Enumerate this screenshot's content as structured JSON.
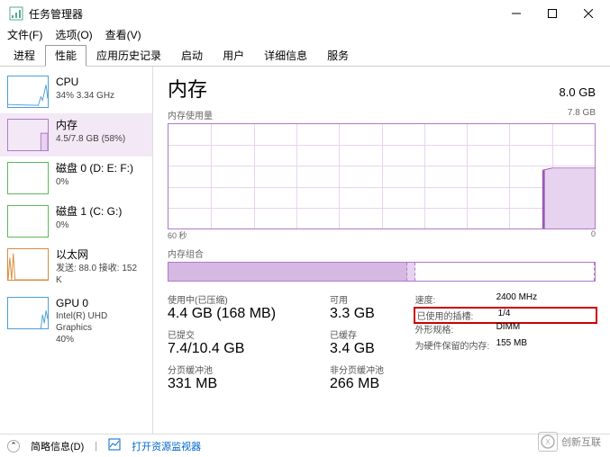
{
  "window": {
    "title": "任务管理器"
  },
  "menu": {
    "file": "文件(F)",
    "options": "选项(O)",
    "view": "查看(V)"
  },
  "tabs": {
    "processes": "进程",
    "performance": "性能",
    "app_history": "应用历史记录",
    "startup": "启动",
    "users": "用户",
    "details": "详细信息",
    "services": "服务"
  },
  "sidebar": {
    "cpu": {
      "name": "CPU",
      "sub": "34% 3.34 GHz"
    },
    "memory": {
      "name": "内存",
      "sub": "4.5/7.8 GB (58%)"
    },
    "disk0": {
      "name": "磁盘 0 (D: E: F:)",
      "sub": "0%"
    },
    "disk1": {
      "name": "磁盘 1 (C: G:)",
      "sub": "0%"
    },
    "ethernet": {
      "name": "以太网",
      "sub": "发送: 88.0 接收: 152 K"
    },
    "gpu": {
      "name": "GPU 0",
      "sub": "Intel(R) UHD Graphics",
      "sub2": "40%"
    }
  },
  "main": {
    "title": "内存",
    "capacity": "8.0 GB",
    "usage_label": "内存使用量",
    "usage_max": "7.8 GB",
    "axis_left": "60 秒",
    "axis_right": "0",
    "composition_label": "内存组合",
    "stats": {
      "in_use_label": "使用中(已压缩)",
      "in_use_value": "4.4 GB (168 MB)",
      "available_label": "可用",
      "available_value": "3.3 GB",
      "committed_label": "已提交",
      "committed_value": "7.4/10.4 GB",
      "cached_label": "已缓存",
      "cached_value": "3.4 GB",
      "paged_label": "分页缓冲池",
      "paged_value": "331 MB",
      "nonpaged_label": "非分页缓冲池",
      "nonpaged_value": "266 MB"
    },
    "info": {
      "speed_k": "速度:",
      "speed_v": "2400 MHz",
      "slots_k": "已使用的插槽:",
      "slots_v": "1/4",
      "form_k": "外形规格:",
      "form_v": "DIMM",
      "reserved_k": "为硬件保留的内存:",
      "reserved_v": "155 MB"
    }
  },
  "footer": {
    "fewer": "简略信息(D)",
    "monitor": "打开资源监视器"
  },
  "watermark": "创新互联",
  "chart_data": {
    "type": "area",
    "title": "内存使用量",
    "xlabel": "60 秒 → 0",
    "ylabel": "GB",
    "ylim": [
      0,
      7.8
    ],
    "x_seconds_ago": [
      60,
      55,
      50,
      45,
      40,
      35,
      30,
      25,
      20,
      15,
      10,
      5,
      0
    ],
    "values_gb": [
      0,
      0,
      0,
      0,
      0,
      0,
      0,
      0,
      0,
      0,
      0,
      4.5,
      4.5
    ]
  }
}
